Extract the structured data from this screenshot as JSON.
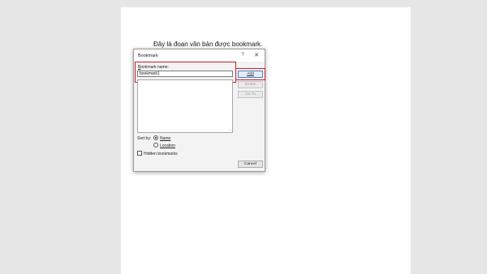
{
  "document": {
    "text": "Đây là đoạn văn bản được bookmark."
  },
  "dialog": {
    "title": "Bookmark",
    "help_label": "?",
    "close_label": "✕",
    "name_label": "Bookmark name:",
    "name_value": "bookmark1",
    "buttons": {
      "add": "Add",
      "delete": "Delete",
      "goto": "Go To",
      "cancel": "Cancel"
    },
    "sort_by_label": "Sort by:",
    "sort_options": [
      {
        "label": "Name",
        "selected": true
      },
      {
        "label": "Location",
        "selected": false
      }
    ],
    "hidden_bookmarks_label": "Hidden bookmarks",
    "hidden_bookmarks_checked": false
  },
  "colors": {
    "highlight": "#c0202a",
    "page_background": "#e6e6e6",
    "default_button_border": "#4a7fc0"
  },
  "icons": [
    "help-icon",
    "close-icon"
  ]
}
